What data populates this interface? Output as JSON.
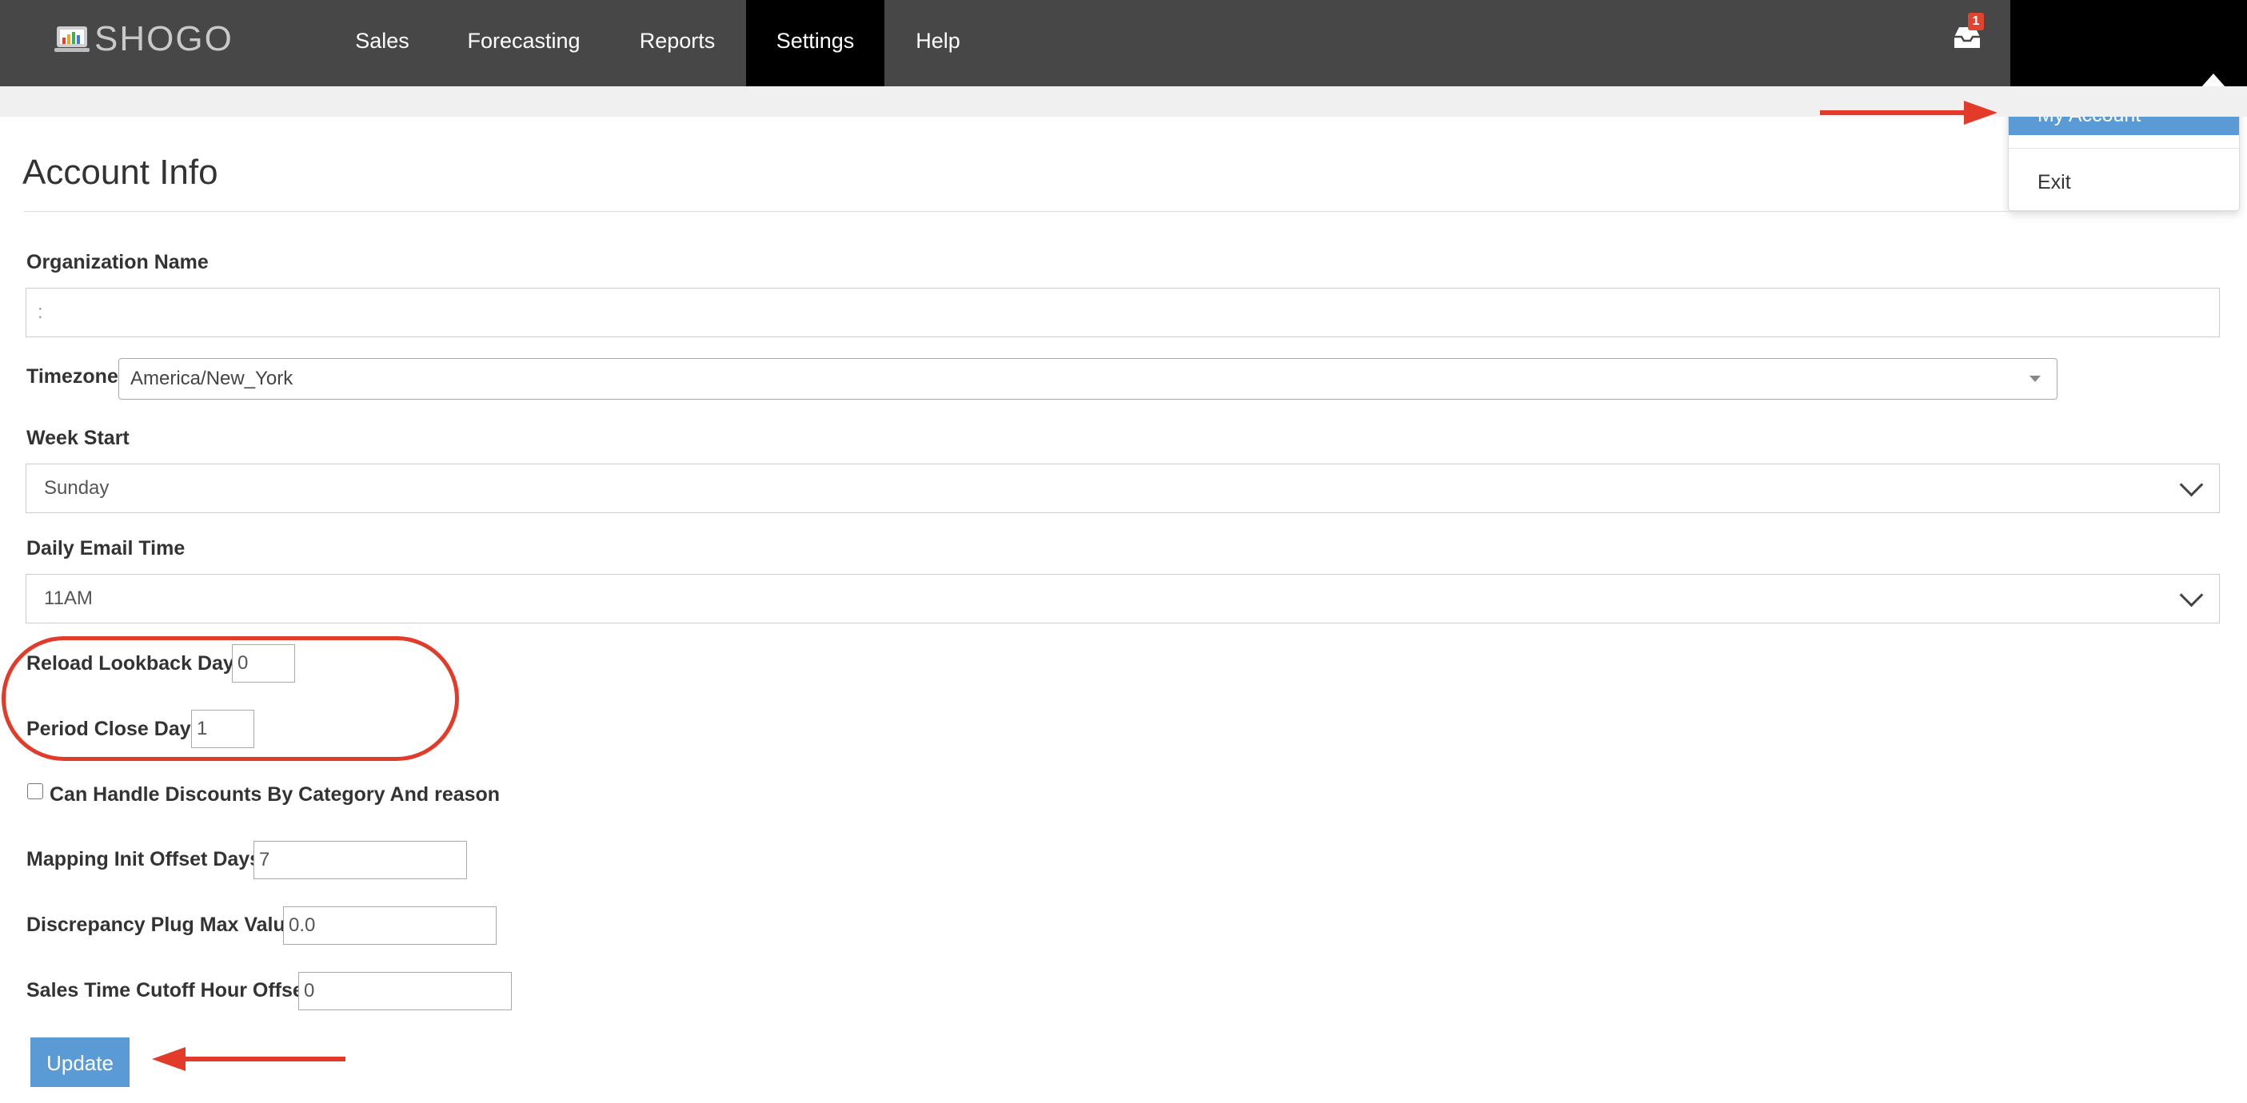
{
  "brand": {
    "name": "SHOGO"
  },
  "nav": {
    "items": [
      {
        "label": "Sales"
      },
      {
        "label": "Forecasting"
      },
      {
        "label": "Reports"
      },
      {
        "label": "Settings",
        "active": true
      },
      {
        "label": "Help"
      }
    ],
    "inbox_badge": "1"
  },
  "user_menu": {
    "items": [
      {
        "label": "My Account",
        "highlighted": true
      },
      {
        "label": "Exit"
      }
    ]
  },
  "page": {
    "title": "Account Info"
  },
  "form": {
    "organization_name": {
      "label": "Organization Name",
      "value": ":"
    },
    "timezone": {
      "label": "Timezone",
      "value": "America/New_York"
    },
    "week_start": {
      "label": "Week Start",
      "value": "Sunday"
    },
    "daily_email_time": {
      "label": "Daily Email Time",
      "value": "11AM"
    },
    "reload_lookback_days": {
      "label": "Reload Lookback Days",
      "value": "0"
    },
    "period_close_days": {
      "label": "Period Close Days",
      "value": "1"
    },
    "discounts_by_category": {
      "label": "Can Handle Discounts By Category And reason",
      "checked": false
    },
    "mapping_init_offset_days": {
      "label": "Mapping Init Offset Days",
      "value": "7"
    },
    "discrepancy_plug_max_value": {
      "label": "Discrepancy Plug Max Value",
      "value": "0.0"
    },
    "sales_time_cutoff_hour_offset": {
      "label": "Sales Time Cutoff Hour Offset",
      "value": "0"
    },
    "update_label": "Update"
  },
  "colors": {
    "nav_bg": "#474747",
    "nav_active": "#000000",
    "accent": "#5b9bd5",
    "annotation": "#e23b2a",
    "badge": "#e0442f"
  }
}
